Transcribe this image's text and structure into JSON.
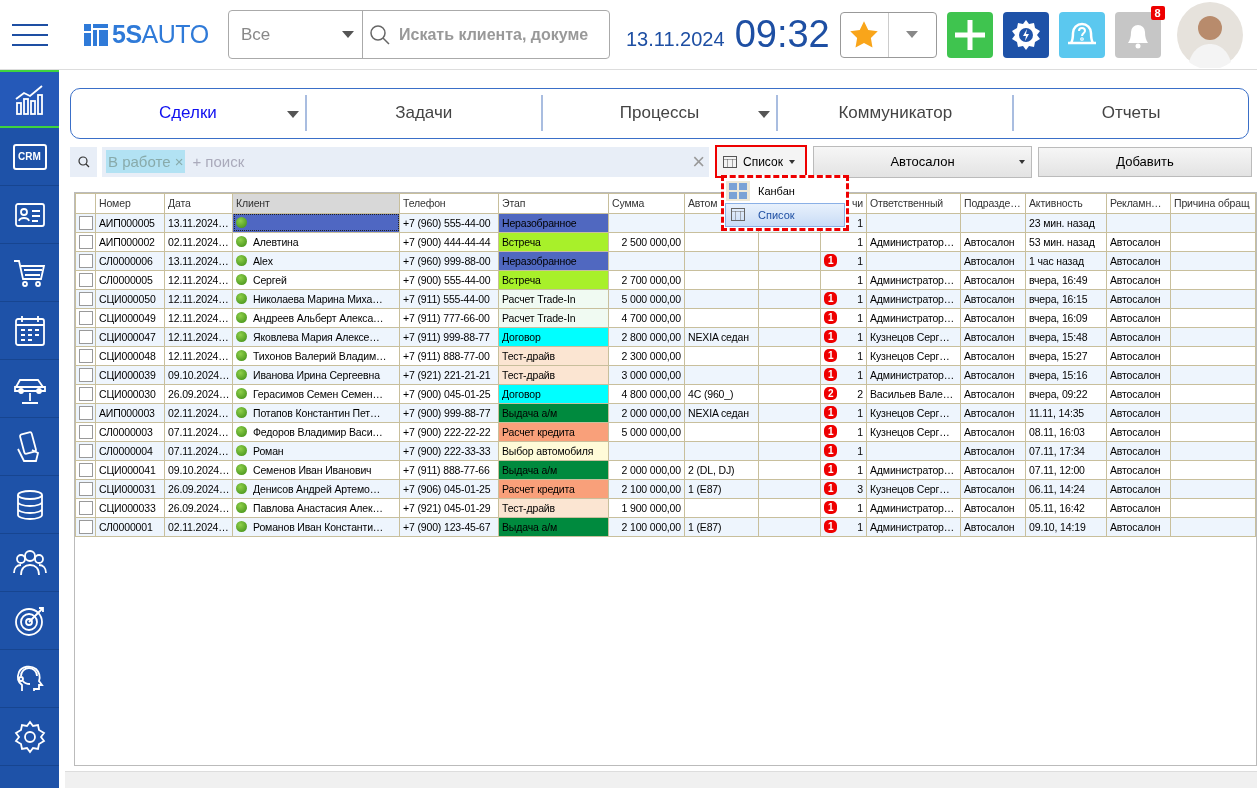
{
  "header": {
    "logo": "**5S**AUTO",
    "scope_select": "Все",
    "search": {
      "placeholder": "Искать клиента, докуме"
    },
    "date": "13.11.2024",
    "time": "09:32",
    "notifications_badge": "8"
  },
  "sidebar": {
    "items": [
      {
        "kind": "chart",
        "selected": true
      },
      {
        "kind": "crm",
        "label": "CRM",
        "selected": false
      },
      {
        "kind": "contacts",
        "selected": false
      },
      {
        "kind": "cart",
        "selected": false
      },
      {
        "kind": "calendar",
        "selected": false
      },
      {
        "kind": "car",
        "selected": false
      },
      {
        "kind": "phone",
        "selected": false
      },
      {
        "kind": "coins",
        "selected": false
      },
      {
        "kind": "people",
        "selected": false
      },
      {
        "kind": "target",
        "selected": false
      },
      {
        "kind": "support",
        "selected": false
      },
      {
        "kind": "settings",
        "selected": false
      }
    ]
  },
  "tabs": [
    {
      "label": "Сделки",
      "selected": true,
      "has_menu": true
    },
    {
      "label": "Задачи",
      "selected": false,
      "has_menu": false
    },
    {
      "label": "Процессы",
      "selected": false,
      "has_menu": true
    },
    {
      "label": "Коммуникатор",
      "selected": false,
      "has_menu": false
    },
    {
      "label": "Отчеты",
      "selected": false,
      "has_menu": false
    }
  ],
  "filter": {
    "chip": "В работе ×",
    "placeholder": "+ поиск",
    "clear": "×"
  },
  "view_select": {
    "value": "Список",
    "options": [
      {
        "label": "Канбан",
        "kind": "kanban",
        "selected": false
      },
      {
        "label": "Список",
        "kind": "list",
        "selected": true
      }
    ]
  },
  "department_select": "Автосалон",
  "add_button": "Добавить",
  "table": {
    "columns": [
      {
        "label": "Номер",
        "sorted": false
      },
      {
        "label": "Дата",
        "sorted": false
      },
      {
        "label": "Клиент",
        "sorted": true
      },
      {
        "label": "Телефон",
        "sorted": false
      },
      {
        "label": "Этап",
        "sorted": false
      },
      {
        "label": "Сумма",
        "sorted": false
      },
      {
        "label": "Автом",
        "sorted": false
      },
      {},
      {
        "label": "чи",
        "sorted": false
      },
      {
        "label": "Ответственный",
        "sorted": false
      },
      {
        "label": "Подразде…",
        "sorted": false
      },
      {
        "label": "Активность",
        "sorted": false
      },
      {
        "label": "Рекламн…",
        "sorted": false
      },
      {
        "label": "Причина обращ",
        "sorted": false
      }
    ],
    "rows": [
      {
        "checked": false,
        "selected": true,
        "number": "АИП000005",
        "date": "13.11.2024…",
        "client": "",
        "phone": "+7 (960) 555-44-00",
        "stage": "Неразобранное",
        "color": "#5068c0",
        "count": "1",
        "activity": "23 мин. назад"
      },
      {
        "checked": false,
        "selected": false,
        "number": "АИП000002",
        "date": "02.11.2024…",
        "client": "Алевтина",
        "phone": "+7 (900) 444-44-44",
        "stage": "Встреча",
        "color": "#a8f02a",
        "sum": "2 500 000,00",
        "count": "1",
        "responsible": "Администратор…",
        "department": "Автосалон",
        "activity": "53 мин. назад",
        "ad": "Автосалон"
      },
      {
        "checked": false,
        "selected": false,
        "number": "СЛ0000006",
        "date": "13.11.2024…",
        "client": "Alex",
        "phone": "+7 (960) 999-88-00",
        "stage": "Неразобранное",
        "color": "#5068c0",
        "badge": "1",
        "count": "1",
        "department": "Автосалон",
        "activity": "1 час назад",
        "ad": "Автосалон"
      },
      {
        "checked": false,
        "selected": false,
        "number": "СЛ0000005",
        "date": "12.11.2024…",
        "client": "Сергей",
        "phone": "+7 (900) 555-44-00",
        "stage": "Встреча",
        "color": "#a8f02a",
        "sum": "2 700 000,00",
        "count": "1",
        "responsible": "Администратор…",
        "department": "Автосалон",
        "activity": "вчера, 16:49",
        "ad": "Автосалон"
      },
      {
        "checked": false,
        "selected": false,
        "number": "СЦИ000050",
        "date": "12.11.2024…",
        "client": "Николаева Марина Миха…",
        "phone": "+7 (911) 555-44-00",
        "stage": "Расчет Trade-In",
        "color": "#f0faf2",
        "sum": "5 000 000,00",
        "badge": "1",
        "count": "1",
        "responsible": "Администратор…",
        "department": "Автосалон",
        "activity": "вчера, 16:15",
        "ad": "Автосалон"
      },
      {
        "checked": false,
        "selected": false,
        "number": "СЦИ000049",
        "date": "12.11.2024…",
        "client": "Андреев Альберт Алекса…",
        "phone": "+7 (911) 777-66-00",
        "stage": "Расчет Trade-In",
        "color": "#f0faf2",
        "sum": "4 700 000,00",
        "badge": "1",
        "count": "1",
        "responsible": "Администратор…",
        "department": "Автосалон",
        "activity": "вчера, 16:09",
        "ad": "Автосалон"
      },
      {
        "checked": false,
        "selected": false,
        "number": "СЦИ000047",
        "date": "12.11.2024…",
        "client": "Яковлева Мария Алексе…",
        "phone": "+7 (911) 999-88-77",
        "stage": "Договор",
        "color": "#00ffff",
        "sum": "2 800 000,00",
        "car": "NEXIA седан",
        "badge": "1",
        "count": "1",
        "responsible": "Кузнецов Серг…",
        "department": "Автосалон",
        "activity": "вчера, 15:48",
        "ad": "Автосалон"
      },
      {
        "checked": false,
        "selected": false,
        "number": "СЦИ000048",
        "date": "12.11.2024…",
        "client": "Тихонов Валерий Владим…",
        "phone": "+7 (911) 888-77-00",
        "stage": "Тест-драйв",
        "color": "#fbe5d2",
        "sum": "2 300 000,00",
        "badge": "1",
        "count": "1",
        "responsible": "Кузнецов Серг…",
        "department": "Автосалон",
        "activity": "вчера, 15:27",
        "ad": "Автосалон"
      },
      {
        "checked": false,
        "selected": false,
        "number": "СЦИ000039",
        "date": "09.10.2024…",
        "client": "Иванова Ирина Сергеевна",
        "phone": "+7 (921) 221-21-21",
        "stage": "Тест-драйв",
        "color": "#fbe5d2",
        "sum": "3 000 000,00",
        "badge": "1",
        "count": "1",
        "responsible": "Администратор…",
        "department": "Автосалон",
        "activity": "вчера, 15:16",
        "ad": "Автосалон"
      },
      {
        "checked": false,
        "selected": false,
        "number": "СЦИ000030",
        "date": "26.09.2024…",
        "client": "Герасимов Семен Семен…",
        "phone": "+7 (900) 045-01-25",
        "stage": "Договор",
        "color": "#00ffff",
        "sum": "4 800 000,00",
        "car": "4C (960_)",
        "badge": "2",
        "count": "2",
        "responsible": "Васильев Вале…",
        "department": "Автосалон",
        "activity": "вчера, 09:22",
        "ad": "Автосалон"
      },
      {
        "checked": false,
        "selected": false,
        "number": "АИП000003",
        "date": "02.11.2024…",
        "client": "Потапов Константин Пет…",
        "phone": "+7 (900) 999-88-77",
        "stage": "Выдача а/м",
        "color": "#008a3e",
        "sum": "2 000 000,00",
        "car": "NEXIA седан",
        "badge": "1",
        "count": "1",
        "responsible": "Кузнецов Серг…",
        "department": "Автосалон",
        "activity": "11.11, 14:35",
        "ad": "Автосалон"
      },
      {
        "checked": false,
        "selected": false,
        "number": "СЛ0000003",
        "date": "07.11.2024…",
        "client": "Федоров Владимир Васи…",
        "phone": "+7 (900) 222-22-22",
        "stage": "Расчет кредита",
        "color": "#f9a07a",
        "sum": "5 000 000,00",
        "badge": "1",
        "count": "1",
        "responsible": "Кузнецов Серг…",
        "department": "Автосалон",
        "activity": "08.11, 16:03",
        "ad": "Автосалон"
      },
      {
        "checked": false,
        "selected": false,
        "number": "СЛ0000004",
        "date": "07.11.2024…",
        "client": "Роман",
        "phone": "+7 (900) 222-33-33",
        "stage": "Выбор автомобиля",
        "color": "#fffbd8",
        "badge": "1",
        "count": "1",
        "department": "Автосалон",
        "activity": "07.11, 17:34",
        "ad": "Автосалон"
      },
      {
        "checked": false,
        "selected": false,
        "number": "СЦИ000041",
        "date": "09.10.2024…",
        "client": "Семенов Иван Иванович",
        "phone": "+7 (911) 888-77-66",
        "stage": "Выдача а/м",
        "color": "#008a3e",
        "sum": "2 000 000,00",
        "car": "2 (DL, DJ)",
        "badge": "1",
        "count": "1",
        "responsible": "Администратор…",
        "department": "Автосалон",
        "activity": "07.11, 12:00",
        "ad": "Автосалон"
      },
      {
        "checked": false,
        "selected": false,
        "number": "СЦИ000031",
        "date": "26.09.2024…",
        "client": "Денисов Андрей Артемо…",
        "phone": "+7 (906) 045-01-25",
        "stage": "Расчет кредита",
        "color": "#f9a07a",
        "sum": "2 100 000,00",
        "car": "1 (E87)",
        "badge": "1",
        "count": "3",
        "responsible": "Кузнецов Серг…",
        "department": "Автосалон",
        "activity": "06.11, 14:24",
        "ad": "Автосалон"
      },
      {
        "checked": false,
        "selected": false,
        "number": "СЦИ000033",
        "date": "26.09.2024…",
        "client": "Павлова Анастасия Алек…",
        "phone": "+7 (921) 045-01-29",
        "stage": "Тест-драйв",
        "color": "#fbe5d2",
        "sum": "1 900 000,00",
        "badge": "1",
        "count": "1",
        "responsible": "Администратор…",
        "department": "Автосалон",
        "activity": "05.11, 16:42",
        "ad": "Автосалон"
      },
      {
        "checked": false,
        "selected": false,
        "number": "СЛ0000001",
        "date": "02.11.2024…",
        "client": "Романов Иван Константи…",
        "phone": "+7 (900) 123-45-67",
        "stage": "Выдача а/м",
        "color": "#008a3e",
        "sum": "2 100 000,00",
        "car": "1 (E87)",
        "badge": "1",
        "count": "1",
        "responsible": "Администратор…",
        "department": "Автосалон",
        "activity": "09.10, 14:19",
        "ad": "Автосалон"
      }
    ]
  }
}
